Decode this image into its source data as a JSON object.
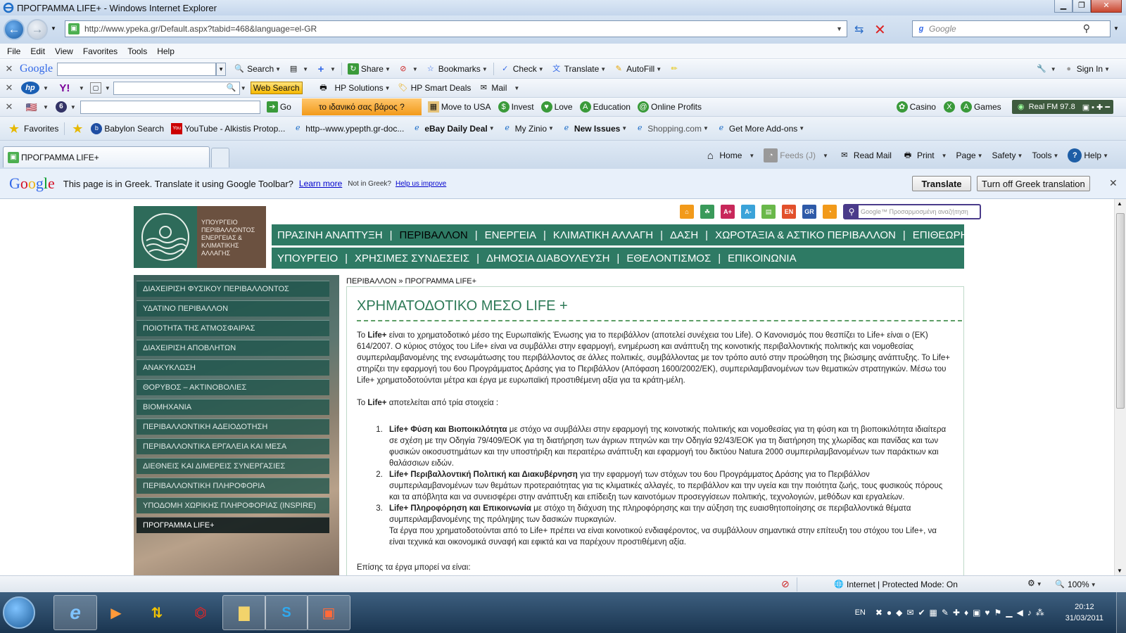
{
  "window": {
    "title": "ΠΡΟΓΡΑΜΜΑ LIFE+ - Windows Internet Explorer"
  },
  "address": {
    "url": "http://www.ypeka.gr/Default.aspx?tabid=468&language=el-GR",
    "search_placeholder": "Google"
  },
  "menu": [
    "File",
    "Edit",
    "View",
    "Favorites",
    "Tools",
    "Help"
  ],
  "google_toolbar": {
    "logo": "Google",
    "search": "Search",
    "share": "Share",
    "bookmarks": "Bookmarks",
    "check": "Check",
    "translate": "Translate",
    "autofill": "AutoFill",
    "sign_in": "Sign In"
  },
  "hp_toolbar": {
    "web_search": "Web Search",
    "hp_solutions": "HP Solutions",
    "smart_deals": "HP Smart Deals",
    "mail": "Mail"
  },
  "third_toolbar": {
    "go": "Go",
    "promo": "το ιδανικό σας βάρος ?",
    "move_usa": "Move to USA",
    "invest": "Invest",
    "love": "Love",
    "education": "Education",
    "online_profits": "Online Profits",
    "casino": "Casino",
    "games": "Games",
    "radio": "Real FM 97.8"
  },
  "favorites_bar": {
    "favorites": "Favorites",
    "items": [
      "Babylon Search",
      "YouTube - Alkistis Protop...",
      "http--www.ypepth.gr-doc...",
      "eBay Daily Deal",
      "My Zinio",
      "New Issues",
      "Shopping.com",
      "Get More Add-ons"
    ]
  },
  "tab": {
    "title": "ΠΡΟΓΡΑΜΜΑ LIFE+"
  },
  "command_bar": {
    "home": "Home",
    "feeds": "Feeds (J)",
    "read_mail": "Read Mail",
    "print": "Print",
    "page": "Page",
    "safety": "Safety",
    "tools": "Tools",
    "help": "Help"
  },
  "translate_bar": {
    "logo": "Google",
    "message": "This page is in Greek.  Translate it using Google Toolbar?",
    "learn_more": "Learn more",
    "not_greek": "Not in Greek?",
    "help_improve": "Help us improve",
    "translate_btn": "Translate",
    "turn_off_btn": "Turn off Greek translation"
  },
  "site": {
    "logo_text": "ΥΠΟΥΡΓΕΙΟ ΠΕΡΙΒΑΛΛΟΝΤΟΣ ΕΝΕΡΓΕΙΑΣ & ΚΛΙΜΑΤΙΚΗΣ ΑΛΛΑΓΗΣ",
    "icon_labels": [
      "A+",
      "A-",
      "EN",
      "GR"
    ],
    "search_placeholder": "Google™ Προσαρμοσμένη αναζήτηση",
    "nav1": [
      "ΠΡΑΣΙΝΗ ΑΝΑΠΤΥΞΗ",
      "ΠΕΡΙΒΑΛΛΟΝ",
      "ΕΝΕΡΓΕΙΑ",
      "ΚΛΙΜΑΤΙΚΗ ΑΛΛΑΓΗ",
      "ΔΑΣΗ",
      "ΧΩΡΟΤΑΞΙΑ & ΑΣΤΙΚΟ ΠΕΡΙΒΑΛΛΟΝ",
      "ΕΠΙΘΕΩΡΗΣΗ"
    ],
    "nav2": [
      "ΥΠΟΥΡΓΕΙΟ",
      "ΧΡΗΣΙΜΕΣ ΣΥΝΔΕΣΕΙΣ",
      "ΔΗΜΟΣΙΑ ΔΙΑΒΟΥΛΕΥΣΗ",
      "ΕΘΕΛΟΝΤΙΣΜΟΣ",
      "ΕΠΙΚΟΙΝΩΝΙΑ"
    ],
    "sidebar": [
      "ΔΙΑΧΕΙΡΙΣΗ ΦΥΣΙΚΟΥ ΠΕΡΙΒΑΛΛΟΝΤΟΣ",
      "ΥΔΑΤΙΝΟ ΠΕΡΙΒΑΛΛΟΝ",
      "ΠΟΙΟΤΗΤΑ ΤΗΣ ΑΤΜΟΣΦΑΙΡΑΣ",
      "ΔΙΑΧΕΙΡΙΣΗ ΑΠΟΒΛΗΤΩΝ",
      "ΑΝΑΚΥΚΛΩΣΗ",
      "ΘΟΡΥΒΟΣ – ΑΚΤΙΝΟΒΟΛΙΕΣ",
      "ΒΙΟΜΗΧΑΝΙΑ",
      "ΠΕΡΙΒΑΛΛΟΝΤΙΚΗ ΑΔΕΙΟΔΟΤΗΣΗ",
      "ΠΕΡΙΒΑΛΛΟΝΤΙΚΑ ΕΡΓΑΛΕΙΑ ΚΑΙ ΜΕΣΑ",
      "ΔΙΕΘΝΕΙΣ ΚΑΙ ΔΙΜΕΡΕΙΣ ΣΥΝΕΡΓΑΣΙΕΣ",
      "ΠΕΡΙΒΑΛΛΟΝΤΙΚΗ ΠΛΗΡΟΦΟΡΙΑ",
      "ΥΠΟΔΟΜΗ ΧΩΡΙΚΗΣ ΠΛΗΡΟΦΟΡΙΑΣ (INSPIRE)",
      "ΠΡΟΓΡΑΜΜΑ LIFE+"
    ],
    "breadcrumb": "ΠΕΡΙΒΑΛΛΟΝ » ΠΡΟΓΡΑΜΜΑ LIFE+",
    "title": "ΧΡΗΜΑΤΟΔΟΤΙΚΟ ΜΕΣΟ LIFE +",
    "intro_pre": "Το ",
    "intro_bold": "Life+",
    "intro_post": " είναι το χρηματοδοτικό μέσο της Ευρωπαϊκής Ένωσης για το περιβάλλον (αποτελεί συνέχεια του Life). Ο Κανονισμός που θεσπίζει το Life+ είναι ο (ΕΚ) 614/2007. Ο κύριος στόχος του Life+ είναι να συμβάλλει στην εφαρμογή, ενημέρωση και ανάπτυξη της κοινοτικής περιβαλλοντικής πολιτικής και νομοθεσίας συμπεριλαμβανομένης της ενσωμάτωσης του περιβάλλοντος σε άλλες πολιτικές, συμβάλλοντας με τον τρόπο αυτό στην προώθηση της βιώσιμης ανάπτυξης. Το Life+ στηρίζει την εφαρμογή του 6ου Προγράμματος Δράσης για το Περιβάλλον (Απόφαση 1600/2002/ΕΚ), συμπεριλαμβανομένων των θεματικών στρατηγικών. Μέσω του Life+ χρηματοδοτούνται μέτρα και έργα με ευρωπαϊκή προστιθέμενη αξία για τα κράτη-μέλη.",
    "elements_pre": "Το ",
    "elements_bold": "Life+",
    "elements_post": " αποτελείται από τρία στοιχεία :",
    "items": [
      {
        "bold": "Life+ Φύση και Βιοποικιλότητα",
        "text": " με στόχο να συμβάλλει στην εφαρμογή της κοινοτικής πολιτικής και νομοθεσίας για τη φύση και τη βιοποικιλότητα ιδιαίτερα σε σχέση με την Οδηγία 79/409/ΕΟΚ για τη διατήρηση των άγριων πτηνών και την Οδηγία 92/43/ΕΟΚ για τη διατήρηση της χλωρίδας και πανίδας και των φυσικών οικοσυστημάτων και την υποστήριξη και περαιτέρω ανάπτυξη και εφαρμογή του δικτύου Natura 2000 συμπεριλαμβανομένων των παράκτιων και θαλάσσιων ειδών."
      },
      {
        "bold": "Life+ Περιβαλλοντική Πολιτική και Διακυβέρνηση",
        "text": " για την εφαρμογή των στόχων του 6ου Προγράμματος Δράσης για το Περιβάλλον συμπεριλαμβανομένων των θεμάτων προτεραιότητας για τις κλιματικές αλλαγές, το περιβάλλον και την υγεία και την ποιότητα ζωής, τους φυσικούς πόρους και τα απόβλητα και να συνεισφέρει στην ανάπτυξη και επίδειξη των καινοτόμων προσεγγίσεων πολιτικής, τεχνολογιών, μεθόδων και εργαλείων."
      },
      {
        "bold": "Life+ Πληροφόρηση και Επικοινωνία",
        "text": " με στόχο τη διάχυση της πληροφόρησης και την αύξηση της ευαισθητοποίησης σε περιβαλλοντικά θέματα συμπεριλαμβανομένης της πρόληψης των δασικών πυρκαγιών.",
        "extra": "Τα έργα που χρηματοδοτούνται από το Life+ πρέπει να είναι κοινοτικού ενδιαφέροντος, να συμβάλλουν σημαντικά στην επίτευξη του στόχου του Life+, να είναι τεχνικά και οικονομικά συναφή και εφικτά και να παρέχουν προστιθέμενη αξία."
      }
    ],
    "also": "Επίσης τα έργα μπορεί να είναι:"
  },
  "status": {
    "zone": "Internet | Protected Mode: On",
    "zoom": "100%"
  },
  "taskbar": {
    "lang": "EN",
    "time": "20:12",
    "date": "31/03/2011"
  },
  "colors": {
    "site_green": "#2e7a64",
    "title_green": "#2e7a57"
  }
}
